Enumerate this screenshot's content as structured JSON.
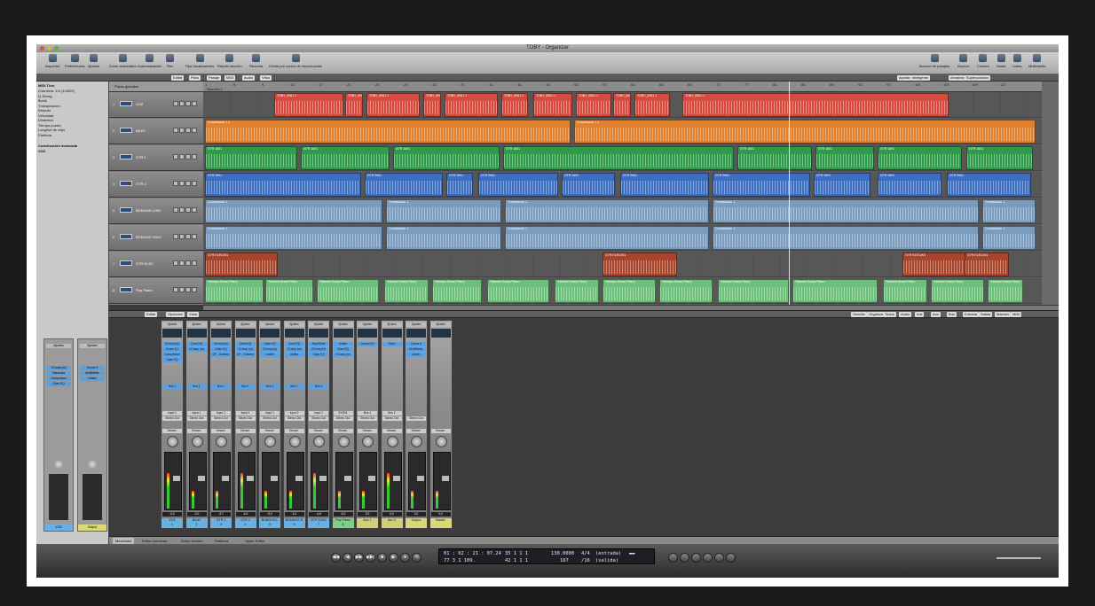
{
  "window": {
    "title": "TOBY - Organizar"
  },
  "toolbar": {
    "items": [
      "Inspector",
      "Preferencias",
      "Ajustes",
      "Zoom automático",
      "Automatización",
      "Flex",
      "Fijar localizadores",
      "Repetir sección",
      "Recortar",
      "Dividir por cursor de reproducción"
    ],
    "right_items": [
      "Bounce de pasajes",
      "Bounce",
      "Colores",
      "Notas",
      "Listas",
      "Multimedia"
    ]
  },
  "subbar": {
    "menus": [
      "Editar",
      "Pista",
      "Pasaje",
      "MIDI",
      "Audio",
      "Vista"
    ],
    "snap": "Ajustar: Inteligente",
    "drag": "Arrastrar: Superposición"
  },
  "inspector": {
    "title": "MIDI Thru",
    "params": [
      "Cuantizar: 1/4 (1/4000)",
      "Q-Swing:",
      "Bucle",
      "Transposición",
      "Retardo",
      "Velocidad",
      "Dinámica",
      "Tiempo puerta",
      "Longitud de clips",
      "Partitura"
    ],
    "sections": [
      "Cuantización avanzada",
      "VOZ"
    ],
    "left_strip": {
      "setting": "Ajustes",
      "eq": "EQ",
      "slots": [
        "VComp (m)",
        "Ganancia",
        "Compressor",
        "Chan EQ"
      ],
      "sends": "Bus 1",
      "io": "Input 1",
      "out": "Stereo Out",
      "auto": "Desact.",
      "name": "VOZ",
      "value": "0,0"
    },
    "right_strip": {
      "setting": "Ajustes",
      "eq": "EQ",
      "slots": [
        "Ozone 5",
        "MultiMeter",
        "Limiter"
      ],
      "auto": "Desact.",
      "name": "Output",
      "value": "0,0"
    }
  },
  "arrange": {
    "globals": "Pistas globales",
    "ruler": [
      "1",
      "5",
      "9",
      "13",
      "17",
      "21",
      "25",
      "29",
      "33",
      "37",
      "41",
      "45",
      "49",
      "53",
      "57",
      "61",
      "65",
      "69",
      "73",
      "77",
      "81",
      "85",
      "89",
      "93",
      "97",
      "101",
      "105",
      "109",
      "113"
    ],
    "marker": "Marcador 1",
    "tracks": [
      {
        "num": "1",
        "name": "VOZ",
        "color": "#d94a3e",
        "clip": "TOBY_0001.1"
      },
      {
        "num": "2",
        "name": "BAJO",
        "color": "#e07f2c",
        "clip": "Compilación 1.1"
      },
      {
        "num": "3",
        "name": "GTR 1",
        "color": "#2f9b4a",
        "clip": "GTR 1#01"
      },
      {
        "num": "4",
        "name": "GTR 2",
        "color": "#3c6fc2",
        "clip": "GTR 2#01"
      },
      {
        "num": "5",
        "name": "BONGOS LOW",
        "color": "#7a9cbf",
        "clip": "Compilación 1"
      },
      {
        "num": "6",
        "name": "BONGOS HIGH",
        "color": "#7a9cbf",
        "clip": "Compilación 1"
      },
      {
        "num": "7",
        "name": "GTR ELEC",
        "color": "#a9452a",
        "clip": "GTR ELEC#01"
      },
      {
        "num": "8",
        "name": "Pop Piano",
        "color": "#6cbf78",
        "clip": "Yamaha Grand Piano"
      }
    ]
  },
  "mixer": {
    "menus": [
      "Editar",
      "Opciones",
      "Vista"
    ],
    "filters": [
      "Sencillo",
      "Organizar",
      "Todos",
      "Audio",
      "Inst",
      "Aux",
      "Bus",
      "Entrada",
      "Salida",
      "Maestro",
      "MIDI"
    ],
    "strips": [
      {
        "name": "VOZ",
        "num": "1",
        "color": "#6ab0e0",
        "slots": [
          "VComp (m)",
          "Ozone 5.1",
          "Compressor",
          "Chan EQ"
        ],
        "send": "Bus 1",
        "in": "Input 1",
        "out": "Stereo Out",
        "auto": "Desact.",
        "val": "-0,0"
      },
      {
        "name": "BAJO",
        "num": "2",
        "color": "#6ab0e0",
        "slots": [
          "Chan EQ",
          "VComp (m)"
        ],
        "send": "Bus 1",
        "in": "Input 1",
        "out": "Stereo Out",
        "auto": "Desact.",
        "val": "-0,0"
      },
      {
        "name": "GTR 1",
        "num": "3",
        "color": "#6ab0e0",
        "slots": [
          "VComp (m)",
          "Chan EQ",
          "GP - Guitarra"
        ],
        "send": "Bus 1",
        "in": "Input 1",
        "out": "Stereo Out",
        "auto": "Desact.",
        "val": "-3,7"
      },
      {
        "name": "GTR 2",
        "num": "4",
        "color": "#6ab0e0",
        "slots": [
          "Chan EQ",
          "VComp (m)",
          "GP - Guitarra"
        ],
        "send": "Bus 1",
        "in": "Input 1",
        "out": "Stereo Out",
        "auto": "Desact.",
        "val": "-4,0"
      },
      {
        "name": "BONGOS L",
        "num": "5",
        "color": "#6ab0e0",
        "slots": [
          "Chan EQ",
          "VComp (m)",
          "Limiter"
        ],
        "send": "Bus 1",
        "in": "Input 1",
        "out": "Stereo Out",
        "auto": "Desact.",
        "val": "-0,0"
      },
      {
        "name": "BONGOS H",
        "num": "6",
        "color": "#6ab0e0",
        "slots": [
          "Chan EQ",
          "VComp (m)",
          "Limiter"
        ],
        "send": "Bus 1",
        "in": "Input 2",
        "out": "Stereo Out",
        "auto": "Desact.",
        "val": "-0,1"
      },
      {
        "name": "GTR ELEC",
        "num": "7",
        "color": "#6ab0e0",
        "slots": [
          "AmpliTube",
          "VComp (m)",
          "Chan EQ"
        ],
        "send": "Bus 1",
        "in": "Input 1",
        "out": "Stereo Out",
        "auto": "Desact.",
        "val": "-4,6"
      },
      {
        "name": "Pop Piano",
        "num": "8",
        "color": "#7fcf8a",
        "slots": [
          "Limiter",
          "Chan EQ",
          "VComp (m)"
        ],
        "send": "",
        "in": "EXS24",
        "out": "Stereo Out",
        "auto": "Desact.",
        "val": "-0,0"
      },
      {
        "name": "Aux 1",
        "num": "",
        "color": "#cfcf7a",
        "slots": [
          "Ozone 5 R"
        ],
        "send": "",
        "in": "Bus 1",
        "out": "Stereo Out",
        "auto": "Desact.",
        "val": "0,0"
      },
      {
        "name": "Aux 2",
        "num": "",
        "color": "#cfcf7a",
        "slots": [
          "Echo"
        ],
        "send": "",
        "in": "Bus 2",
        "out": "Stereo Out",
        "auto": "Desact.",
        "val": "0,0"
      },
      {
        "name": "Output",
        "num": "",
        "color": "#d9d97a",
        "slots": [
          "Ozone 5",
          "MultiMeter",
          "Limiter"
        ],
        "send": "",
        "in": "",
        "out": "Stereo Out",
        "auto": "Desact.",
        "val": "0,0"
      },
      {
        "name": "Master",
        "num": "",
        "color": "#d9d97a",
        "slots": [],
        "send": "",
        "in": "",
        "out": "",
        "auto": "Desact.",
        "val": "0,0"
      }
    ]
  },
  "bottom_tabs": [
    "Mezclador",
    "Editor muestras",
    "Editor teclado",
    "Partitura",
    "Hyper Editor"
  ],
  "transport": {
    "smpte": "01 : 02 : 21 : 07.24",
    "smpte2": "77   3   1  109.",
    "bars": "35   1   1     1",
    "bars2": "42   1   1     1",
    "tempo": "130.0000",
    "tempo2": "167",
    "sig": "4/4",
    "div": "/16",
    "in": "(entrada)",
    "out": "(salida)"
  }
}
